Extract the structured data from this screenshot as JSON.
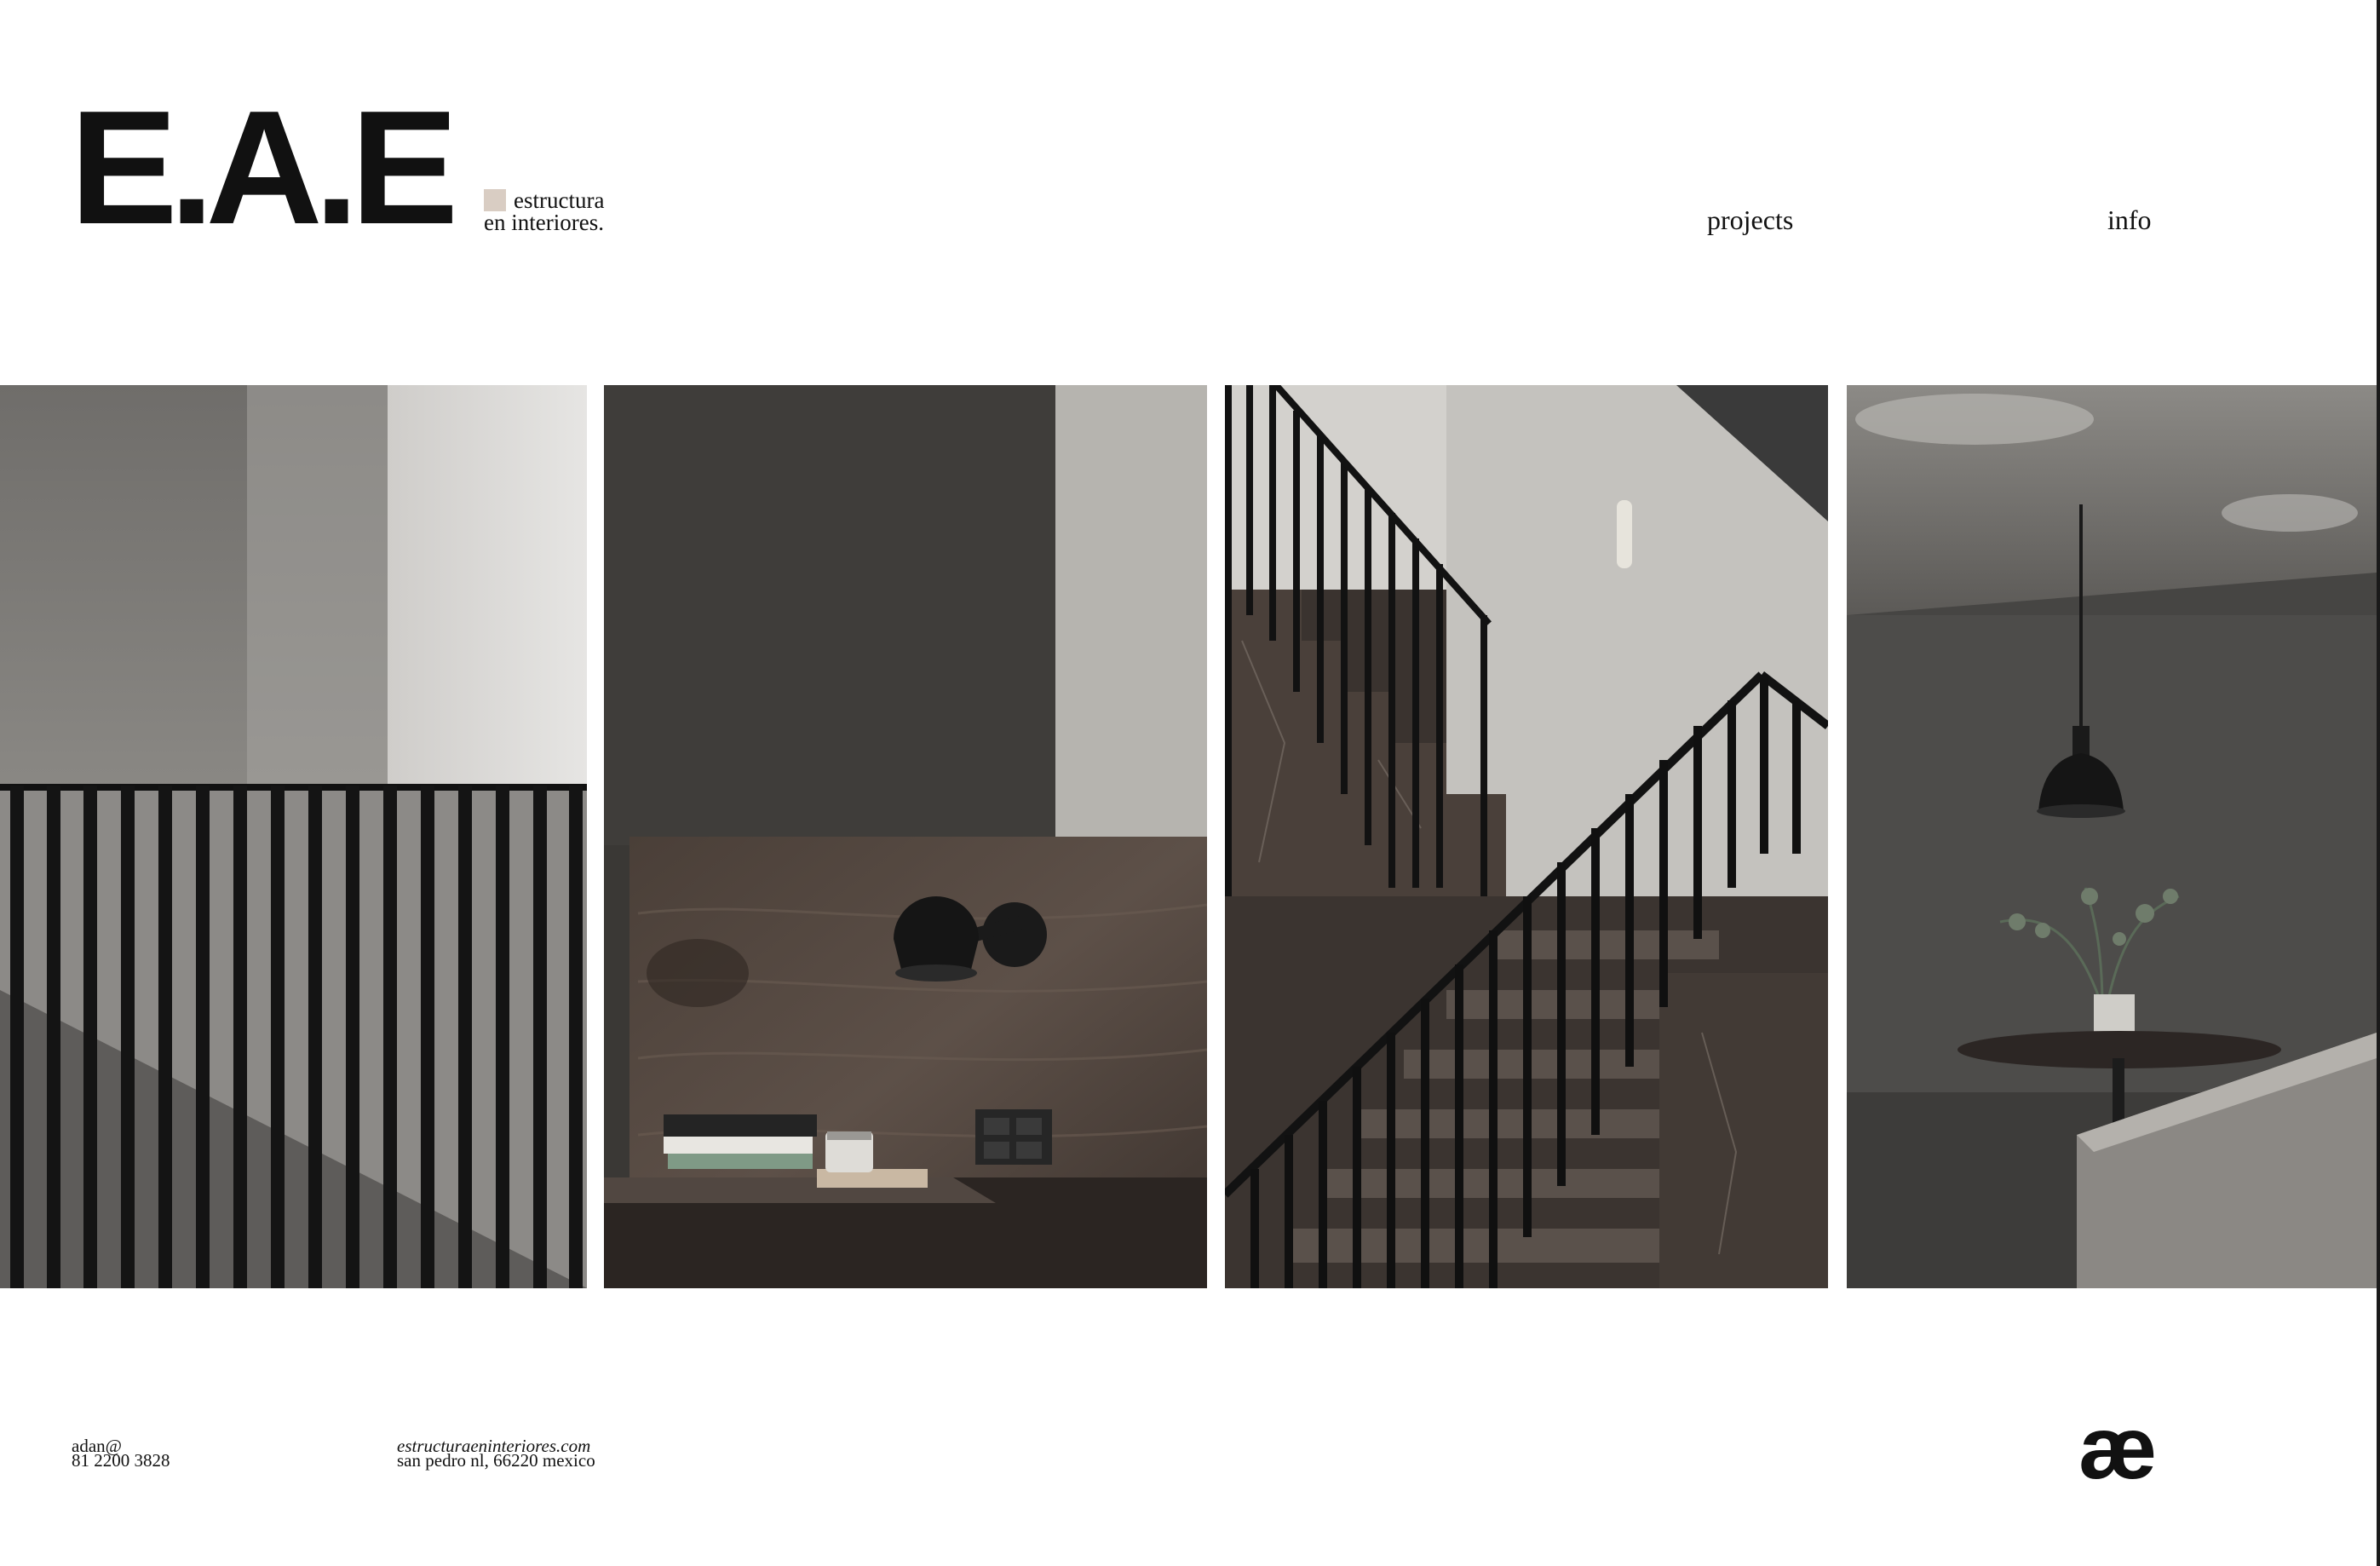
{
  "header": {
    "logo_text": "E.A.E",
    "tagline_line1": "estructura",
    "tagline_line2": "en interiores.",
    "nav": [
      {
        "label": "projects"
      },
      {
        "label": "info"
      }
    ]
  },
  "gallery": {
    "photos": [
      {
        "subject": "stair railing with black vertical bars and skylight"
      },
      {
        "subject": "walnut wall panel with black wall lamp and books"
      },
      {
        "subject": "marble staircase with black metal railing"
      },
      {
        "subject": "dining area with pendant lamp and round table"
      }
    ]
  },
  "footer": {
    "email": "adan@",
    "phone": "81 2200 3828",
    "website": "estructuraeninteriores.com",
    "address": "san pedro nl, 66220 mexico",
    "mark": "æ"
  },
  "colors": {
    "accent_square": "#d9cdc3",
    "text": "#111111",
    "background": "#ffffff"
  }
}
